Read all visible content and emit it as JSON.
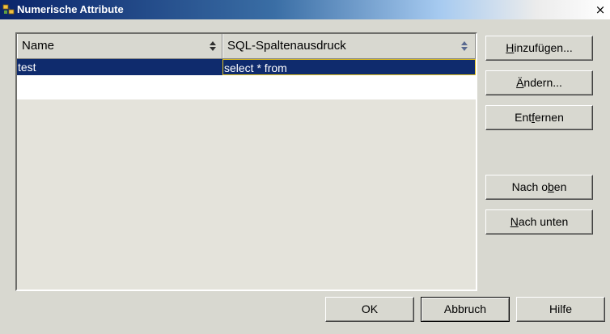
{
  "window": {
    "title": "Numerische Attribute",
    "close_label": "×"
  },
  "table": {
    "columns": [
      {
        "label": "Name",
        "sort_icon": "sort-updown-icon"
      },
      {
        "label": "SQL-Spaltenausdruck",
        "sort_icon": "sort-updown-icon"
      }
    ],
    "rows": [
      {
        "name": "test",
        "expression": "select * from"
      }
    ],
    "selection_color": "#0f2b6d"
  },
  "side_buttons": [
    {
      "pre": "",
      "mn": "H",
      "post": "inzufügen..."
    },
    {
      "pre": "",
      "mn": "Ä",
      "post": "ndern..."
    },
    {
      "pre": "Ent",
      "mn": "f",
      "post": "ernen"
    },
    {
      "pre": "Nach o",
      "mn": "b",
      "post": "en"
    },
    {
      "pre": "",
      "mn": "N",
      "post": "ach unten"
    }
  ],
  "bottom_buttons": {
    "ok": "OK",
    "cancel": "Abbruch",
    "help": "Hilfe"
  }
}
